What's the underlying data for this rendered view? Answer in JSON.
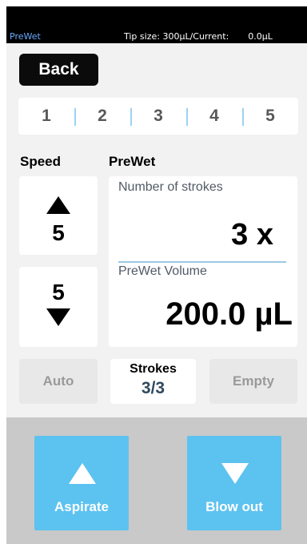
{
  "status_bar": {
    "mode": "PreWet",
    "tip_label": "Tip size: 300µL/Current:",
    "current_value": "0.0µL"
  },
  "back_label": "Back",
  "steps": [
    "1",
    "2",
    "3",
    "4",
    "5"
  ],
  "speed": {
    "label": "Speed",
    "up_value": "5",
    "down_value": "5"
  },
  "prewet": {
    "label": "PreWet",
    "strokes_label": "Number of strokes",
    "strokes_value": "3 x",
    "volume_label": "PreWet Volume",
    "volume_value": "200.0 µL"
  },
  "controls": {
    "auto_label": "Auto",
    "strokes_title": "Strokes",
    "strokes_count": "3/3",
    "empty_label": "Empty"
  },
  "actions": {
    "aspirate_label": "Aspirate",
    "blowout_label": "Blow out"
  },
  "colors": {
    "accent": "#5cc2f0",
    "status_mode": "#6aa8ff",
    "divider": "#9cc9e2"
  },
  "icons": [
    "arrow-up-icon",
    "arrow-down-icon"
  ]
}
